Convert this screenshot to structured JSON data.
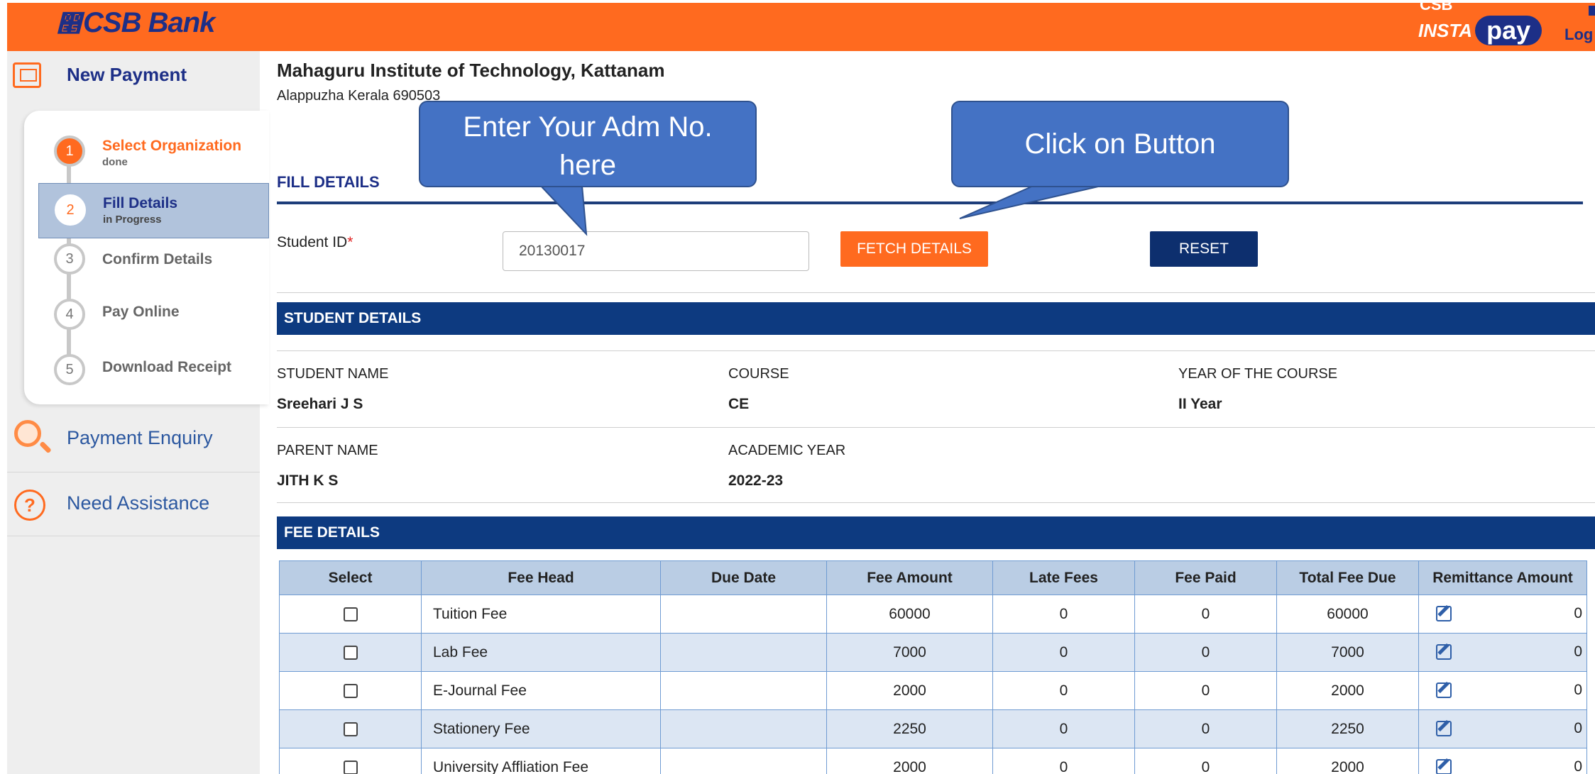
{
  "header": {
    "bank_logo": "CSB Bank",
    "insta_top": "CSB",
    "insta_word": "INSTA",
    "pay_word": "pay",
    "logout_label": "Log"
  },
  "sidebar": {
    "new_payment_label": "New Payment",
    "steps": [
      {
        "num": "1",
        "title": "Select Organization",
        "status": "done"
      },
      {
        "num": "2",
        "title": "Fill Details",
        "status": "in Progress"
      },
      {
        "num": "3",
        "title": "Confirm Details",
        "status": ""
      },
      {
        "num": "4",
        "title": "Pay Online",
        "status": ""
      },
      {
        "num": "5",
        "title": "Download Receipt",
        "status": ""
      }
    ],
    "payment_enquiry_label": "Payment Enquiry",
    "need_assistance_label": "Need Assistance"
  },
  "organization": {
    "name": "Mahaguru Institute of Technology, Kattanam",
    "address": "Alappuzha Kerala 690503"
  },
  "fill_details": {
    "title": "FILL DETAILS",
    "student_id_label": "Student ID",
    "required_mark": "*",
    "student_id_value": "20130017",
    "fetch_button": "FETCH DETAILS",
    "reset_button": "RESET"
  },
  "student_details": {
    "title": "STUDENT DETAILS",
    "student_name_label": "STUDENT NAME",
    "student_name": "Sreehari J S",
    "course_label": "COURSE",
    "course": "CE",
    "year_label": "YEAR OF THE COURSE",
    "year": "II Year",
    "parent_name_label": "PARENT NAME",
    "parent_name": "JITH K S",
    "academic_year_label": "ACADEMIC YEAR",
    "academic_year": "2022-23"
  },
  "fee_details": {
    "title": "FEE DETAILS",
    "columns": [
      "Select",
      "Fee Head",
      "Due Date",
      "Fee Amount",
      "Late Fees",
      "Fee Paid",
      "Total Fee Due",
      "Remittance Amount"
    ],
    "rows": [
      {
        "fee_head": "Tuition Fee",
        "due_date": "",
        "fee_amount": "60000",
        "late_fees": "0",
        "fee_paid": "0",
        "total_due": "60000",
        "remittance": "0"
      },
      {
        "fee_head": "Lab Fee",
        "due_date": "",
        "fee_amount": "7000",
        "late_fees": "0",
        "fee_paid": "0",
        "total_due": "7000",
        "remittance": "0"
      },
      {
        "fee_head": "E-Journal Fee",
        "due_date": "",
        "fee_amount": "2000",
        "late_fees": "0",
        "fee_paid": "0",
        "total_due": "2000",
        "remittance": "0"
      },
      {
        "fee_head": "Stationery Fee",
        "due_date": "",
        "fee_amount": "2250",
        "late_fees": "0",
        "fee_paid": "0",
        "total_due": "2250",
        "remittance": "0"
      },
      {
        "fee_head": "University Affliation Fee",
        "due_date": "",
        "fee_amount": "2000",
        "late_fees": "0",
        "fee_paid": "0",
        "total_due": "2000",
        "remittance": "0"
      }
    ]
  },
  "callouts": {
    "adm_line1": "Enter Your Adm No.",
    "adm_line2": "here",
    "button": "Click on Button"
  },
  "colors": {
    "brand_orange": "#ff6a1f",
    "brand_navy": "#1d2f87",
    "bar_blue": "#0d3a80",
    "callout_blue": "#4472c4"
  },
  "icons": {
    "new_payment": "payment-card-icon",
    "payment_enquiry": "magnifier-icon",
    "need_assistance": "question-icon",
    "remittance_edit": "edit-icon"
  }
}
